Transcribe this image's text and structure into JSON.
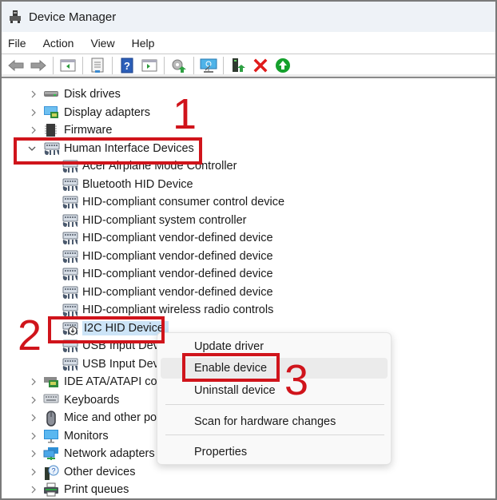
{
  "window": {
    "title": "Device Manager"
  },
  "menu": [
    "File",
    "Action",
    "View",
    "Help"
  ],
  "toolbar": {
    "buttons": [
      {
        "name": "back-icon"
      },
      {
        "name": "forward-icon"
      },
      {
        "name": "show-hide-console-tree-icon"
      },
      {
        "name": "properties-icon"
      },
      {
        "name": "help-icon"
      },
      {
        "name": "show-action-pane-icon"
      },
      {
        "name": "update-driver-icon"
      },
      {
        "name": "scan-hardware-icon"
      },
      {
        "name": "add-driver-icon"
      },
      {
        "name": "uninstall-icon"
      },
      {
        "name": "enable-device-icon"
      }
    ]
  },
  "tree": {
    "categories_before": [
      {
        "label": "Disk drives",
        "icon": "disk-drive-icon"
      },
      {
        "label": "Display adapters",
        "icon": "display-adapter-icon"
      },
      {
        "label": "Firmware",
        "icon": "firmware-icon"
      }
    ],
    "expanded": {
      "label": "Human Interface Devices",
      "icon": "hid-category-icon",
      "children": [
        {
          "label": "Acer Airplane Mode Controller"
        },
        {
          "label": "Bluetooth HID Device"
        },
        {
          "label": "HID-compliant consumer control device"
        },
        {
          "label": "HID-compliant system controller"
        },
        {
          "label": "HID-compliant vendor-defined device"
        },
        {
          "label": "HID-compliant vendor-defined device"
        },
        {
          "label": "HID-compliant vendor-defined device"
        },
        {
          "label": "HID-compliant vendor-defined device"
        },
        {
          "label": "HID-compliant wireless radio controls"
        },
        {
          "label": "I2C HID Device",
          "selected": true,
          "disabled": true
        },
        {
          "label": "USB Input Device"
        },
        {
          "label": "USB Input Device"
        }
      ]
    },
    "categories_after": [
      {
        "label": "IDE ATA/ATAPI controllers",
        "icon": "ide-controller-icon"
      },
      {
        "label": "Keyboards",
        "icon": "keyboard-icon"
      },
      {
        "label": "Mice and other pointing devices",
        "icon": "mouse-icon"
      },
      {
        "label": "Monitors",
        "icon": "monitor-icon"
      },
      {
        "label": "Network adapters",
        "icon": "network-adapter-icon"
      },
      {
        "label": "Other devices",
        "icon": "other-devices-icon"
      },
      {
        "label": "Print queues",
        "icon": "printer-icon"
      }
    ]
  },
  "context_menu": {
    "items": [
      "Update driver",
      "Enable device",
      "Uninstall device",
      "Scan for hardware changes",
      "Properties"
    ],
    "hovered": "Enable device"
  },
  "annotations": {
    "step1": "1",
    "step2": "2",
    "step3": "3",
    "color": "#d0141b"
  }
}
